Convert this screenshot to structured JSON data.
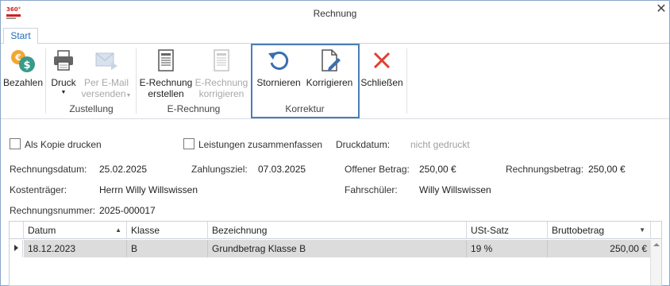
{
  "window": {
    "logo_text": "360°",
    "title": "Rechnung",
    "close_glyph": "✕"
  },
  "tabs": [
    {
      "label": "Start",
      "active": true
    }
  ],
  "ribbon": {
    "bezahlen": {
      "label": "Bezahlen",
      "icon": "coins-icon"
    },
    "druck": {
      "label": "Druck",
      "icon": "printer-icon"
    },
    "email": {
      "label1": "Per E-Mail",
      "label2": "versenden",
      "icon": "email-send-icon",
      "disabled": true
    },
    "erechnung_erstellen": {
      "label1": "E-Rechnung",
      "label2": "erstellen",
      "icon": "document-icon"
    },
    "erechnung_korrigieren": {
      "label1": "E-Rechnung",
      "label2": "korrigieren",
      "icon": "document-icon",
      "disabled": true
    },
    "stornieren": {
      "label": "Stornieren",
      "icon": "undo-icon"
    },
    "korrigieren": {
      "label": "Korrigieren",
      "icon": "edit-document-icon"
    },
    "schliessen": {
      "label": "Schließen",
      "icon": "close-red-icon"
    },
    "groups": {
      "zustellung": "Zustellung",
      "erechnung": "E-Rechnung",
      "korrektur": "Korrektur"
    },
    "dropdown_glyph": "▼"
  },
  "form": {
    "kopie_label": "Als Kopie drucken",
    "leistungen_label": "Leistungen zusammenfassen",
    "druckdatum_label": "Druckdatum:",
    "druckdatum_value": "nicht gedruckt",
    "rechnungsdatum_label": "Rechnungsdatum:",
    "rechnungsdatum_value": "25.02.2025",
    "zahlungsziel_label": "Zahlungsziel:",
    "zahlungsziel_value": "07.03.2025",
    "offener_label": "Offener Betrag:",
    "offener_value": "250,00 €",
    "rechnungsbetrag_label": "Rechnungsbetrag:",
    "rechnungsbetrag_value": "250,00 €",
    "kostentraeger_label": "Kostenträger:",
    "kostentraeger_value": "Herrn Willy Willswissen",
    "fahrschueler_label": "Fahrschüler:",
    "fahrschueler_value": "Willy Willswissen",
    "rechnungsnummer_label": "Rechnungsnummer:",
    "rechnungsnummer_value": "2025-000017"
  },
  "grid": {
    "columns": [
      "Datum",
      "Klasse",
      "Bezeichnung",
      "USt-Satz",
      "Bruttobetrag"
    ],
    "sort_up": "▲",
    "sort_down": "▼",
    "rows": [
      {
        "datum": "18.12.2023",
        "klasse": "B",
        "bezeichnung": "Grundbetrag Klasse B",
        "ust": "19 %",
        "brutto": "250,00 €"
      }
    ]
  }
}
